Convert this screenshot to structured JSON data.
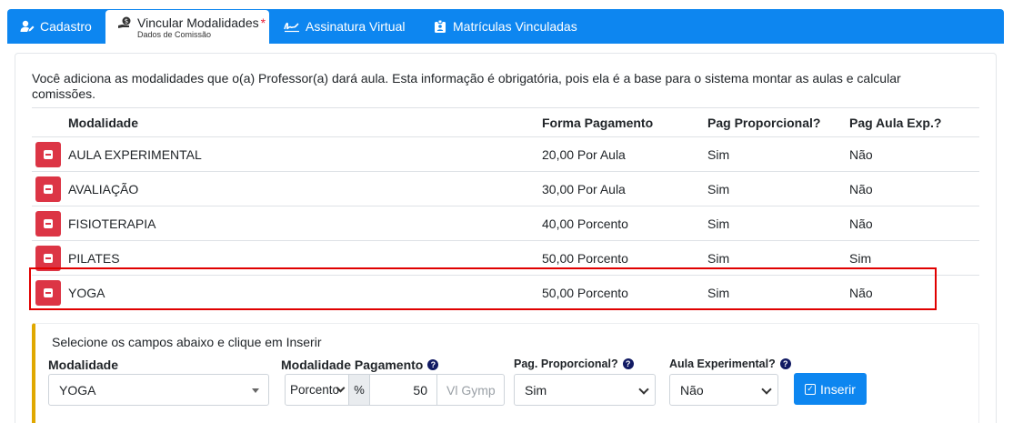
{
  "tabs": [
    {
      "label": "Cadastro",
      "icon": "user-edit-icon"
    },
    {
      "label": "Vincular Modalidades",
      "sublabel": "Dados de Comissão",
      "required": "*",
      "icon": "hand-money-icon",
      "active": true
    },
    {
      "label": "Assinatura Virtual",
      "icon": "signature-icon"
    },
    {
      "label": "Matrículas Vinculadas",
      "icon": "id-badge-icon"
    }
  ],
  "intro_text": "Você adiciona as modalidades que o(a) Professor(a) dará aula. Esta informação é obrigatória, pois ela é a base para o sistema montar as aulas e calcular comissões.",
  "table": {
    "headers": {
      "modalidade": "Modalidade",
      "forma": "Forma Pagamento",
      "proporcional": "Pag Proporcional?",
      "experimental": "Pag Aula Exp.?"
    },
    "rows": [
      {
        "modalidade": "AULA EXPERIMENTAL",
        "forma": "20,00 Por Aula",
        "proporcional": "Sim",
        "experimental": "Não"
      },
      {
        "modalidade": "AVALIAÇÃO",
        "forma": "30,00 Por Aula",
        "proporcional": "Sim",
        "experimental": "Não"
      },
      {
        "modalidade": "FISIOTERAPIA",
        "forma": "40,00 Porcento",
        "proporcional": "Sim",
        "experimental": "Não"
      },
      {
        "modalidade": "PILATES",
        "forma": "50,00 Porcento",
        "proporcional": "Sim",
        "experimental": "Sim"
      },
      {
        "modalidade": "YOGA",
        "forma": "50,00 Porcento",
        "proporcional": "Sim",
        "experimental": "Não"
      }
    ]
  },
  "form": {
    "title": "Selecione os campos abaixo e clique em Inserir",
    "labels": {
      "modalidade": "Modalidade",
      "pagamento": "Modalidade Pagamento",
      "proporcional": "Pag. Proporcional?",
      "experimental": "Aula Experimental?"
    },
    "modalidade_value": "YOGA",
    "tipo_value": "Porcento",
    "percent_symbol": "%",
    "valor_value": "50",
    "vl_placeholder": "Vl Gymp",
    "proporcional_value": "Sim",
    "experimental_value": "Não",
    "inserir_label": "Inserir"
  },
  "colors": {
    "primary": "#0d86f0",
    "danger": "#dc3545",
    "highlight": "#e00000",
    "accent_border": "#e0a800"
  }
}
